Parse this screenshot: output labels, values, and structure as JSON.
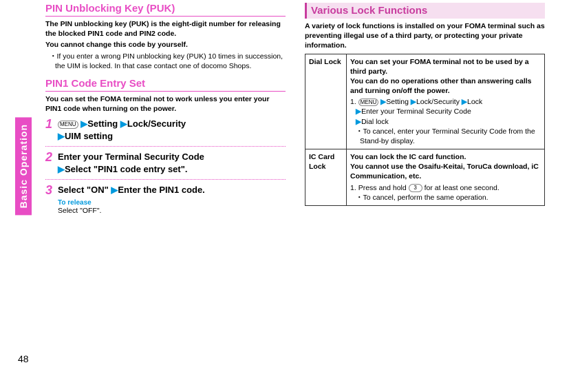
{
  "sideTab": "Basic Operation",
  "pageNumber": "48",
  "left": {
    "puk": {
      "title": "PIN Unblocking Key (PUK)",
      "desc1": "The PIN unblocking key (PUK) is the eight-digit number for releasing the blocked PIN1 code and PIN2 code.",
      "desc2": "You cannot change this code by yourself.",
      "bullet1": "If you enter a wrong PIN unblocking key (PUK) 10 times in succession, the UIM is locked. In that case contact one of docomo Shops."
    },
    "pin1": {
      "title": "PIN1 Code Entry Set",
      "desc": "You can set the FOMA terminal not to work unless you enter your PIN1 code when turning on the power.",
      "step1_pre": "MENU",
      "arrow": "▶",
      "step1a": "Setting",
      "step1b": "Lock/Security",
      "step1c": "UIM setting",
      "step2a": "Enter your Terminal Security Code",
      "step2b": "Select \"PIN1 code entry set\".",
      "step3a": "Select \"ON\"",
      "step3b": "Enter the PIN1 code.",
      "toReleaseLabel": "To release",
      "toReleaseBody": "Select \"OFF\"."
    }
  },
  "right": {
    "title": "Various Lock Functions",
    "intro": "A variety of lock functions is installed on your FOMA terminal such as preventing illegal use of a third party, or protecting your private information.",
    "dialLock": {
      "name": "Dial Lock",
      "desc1": "You can set your FOMA terminal not to be used by a third party.",
      "desc2": "You can do no operations other than answering calls and turning on/off the power.",
      "menuKey": "MENU",
      "nav1": "Setting",
      "nav2": "Lock/Security",
      "nav3": "Lock",
      "nav4": "Enter your Terminal Security Code",
      "nav5": "Dial lock",
      "cancel": "To cancel, enter your Terminal Security Code from the Stand-by display."
    },
    "icLock": {
      "name": "IC Card Lock",
      "desc1": "You can lock the IC card function.",
      "desc2": "You cannot use the Osaifu-Keitai, ToruCa download, iC Communication, etc.",
      "key": "3",
      "step1a": "Press and hold ",
      "step1b": " for at least one second.",
      "cancel": "To cancel, perform the same operation."
    },
    "stepNum1": "1.",
    "arrow": "▶"
  }
}
